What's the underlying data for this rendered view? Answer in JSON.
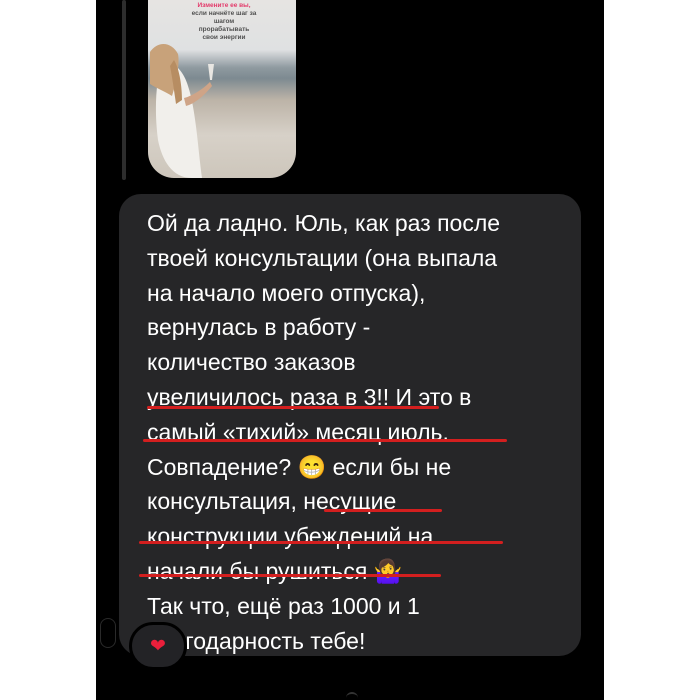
{
  "story": {
    "caption_lines": [
      "Измените ее вы,",
      "если начнёте шаг за",
      "шагом",
      "прорабатывать",
      "свои энергии"
    ]
  },
  "message": {
    "lines": [
      "Ой да ладно. Юль, как раз после",
      "твоей консультации (она выпала",
      "на начало моего отпуска),",
      "вернулась в работу -",
      "количество заказов",
      "увеличилось раза в 3!! И это в",
      "самый «тихий» месяц июль.",
      "Совпадение? 😁 если бы не",
      "консультация, несущие",
      "конструкции убеждений на",
      "начали бы рушиться 🤷‍♀️",
      "Так что, ещё раз 1000 и 1",
      "благодарность тебе!"
    ]
  },
  "reaction": {
    "icon": "heart-icon",
    "glyph": "❤",
    "color": "#ea1f3b"
  },
  "colors": {
    "background": "#000000",
    "bubble": "#262628",
    "underline": "#d31f1f",
    "text": "#ffffff"
  }
}
